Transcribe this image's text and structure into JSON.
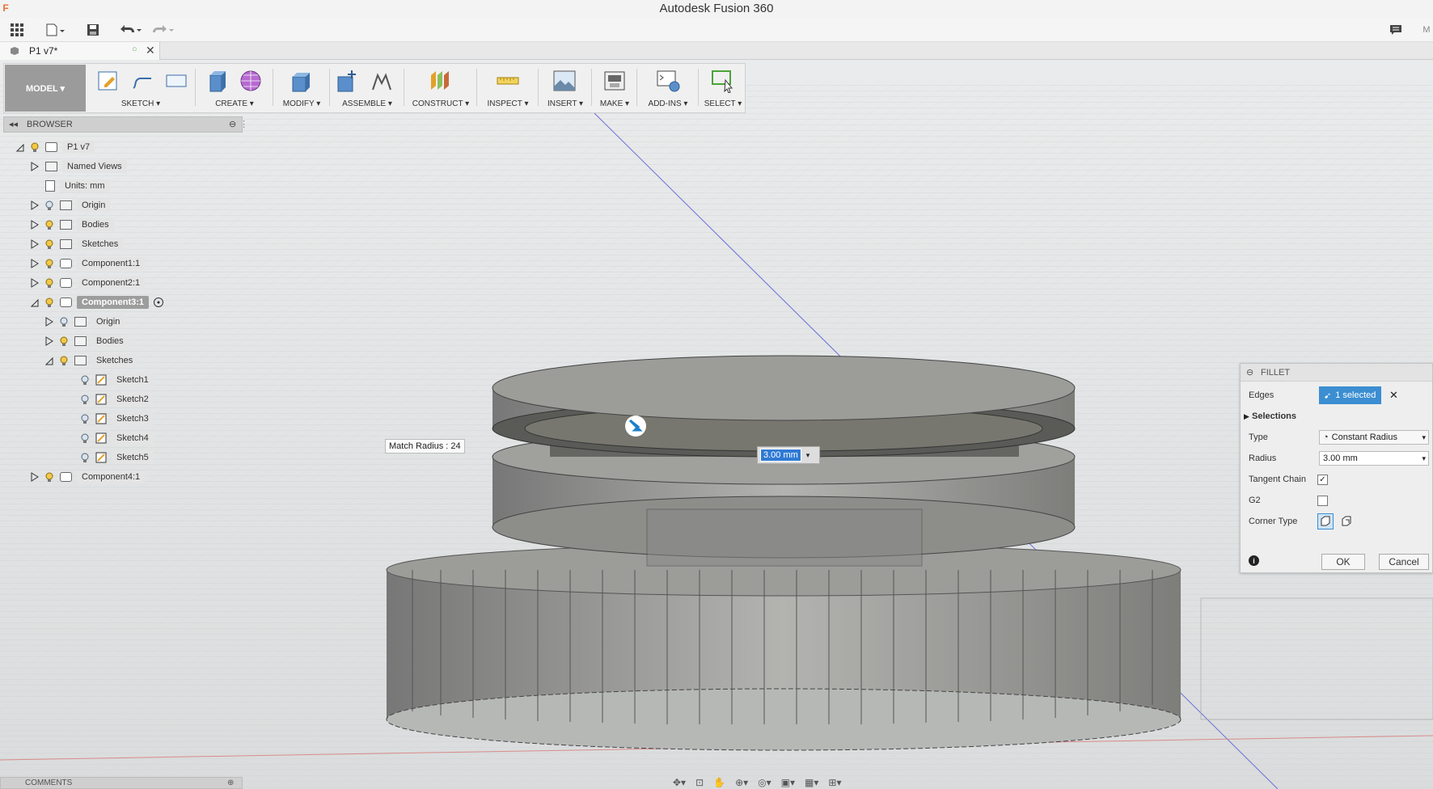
{
  "window": {
    "title": "Autodesk Fusion 360"
  },
  "qat": {
    "grid_icon": "apps-grid-icon",
    "file_icon": "file-icon",
    "save_icon": "save-icon",
    "undo_icon": "undo-icon",
    "redo_icon": "redo-icon",
    "comment_icon": "comment-icon",
    "user_initial": "M"
  },
  "document_tab": {
    "name": "P1 v7*"
  },
  "toolbar": {
    "workspace": "MODEL ▾",
    "groups": [
      {
        "label": "SKETCH ▾"
      },
      {
        "label": "CREATE ▾"
      },
      {
        "label": "MODIFY ▾"
      },
      {
        "label": "ASSEMBLE ▾"
      },
      {
        "label": "CONSTRUCT ▾"
      },
      {
        "label": "INSPECT ▾"
      },
      {
        "label": "INSERT ▾"
      },
      {
        "label": "MAKE ▾"
      },
      {
        "label": "ADD-INS ▾"
      },
      {
        "label": "SELECT ▾"
      }
    ]
  },
  "browser": {
    "title": "BROWSER",
    "items": [
      {
        "label": "P1 v7"
      },
      {
        "label": "Named Views"
      },
      {
        "label": "Units: mm"
      },
      {
        "label": "Origin"
      },
      {
        "label": "Bodies"
      },
      {
        "label": "Sketches"
      },
      {
        "label": "Component1:1"
      },
      {
        "label": "Component2:1"
      },
      {
        "label": "Component3:1"
      },
      {
        "label": "Origin"
      },
      {
        "label": "Bodies"
      },
      {
        "label": "Sketches"
      },
      {
        "label": "Sketch1"
      },
      {
        "label": "Sketch2"
      },
      {
        "label": "Sketch3"
      },
      {
        "label": "Sketch4"
      },
      {
        "label": "Sketch5"
      },
      {
        "label": "Component4:1"
      }
    ]
  },
  "canvas": {
    "match_radius": "Match Radius : 24",
    "radius_input": "3.00 mm"
  },
  "fillet": {
    "title": "FILLET",
    "edges_label": "Edges",
    "edges_value": "1 selected",
    "selections_label": "Selections",
    "type_label": "Type",
    "type_value": "Constant Radius",
    "radius_label": "Radius",
    "radius_value": "3.00 mm",
    "tangent_label": "Tangent Chain",
    "tangent_checked": "✓",
    "g2_label": "G2",
    "corner_label": "Corner Type",
    "ok": "OK",
    "cancel": "Cancel"
  },
  "comments": {
    "title": "COMMENTS"
  }
}
